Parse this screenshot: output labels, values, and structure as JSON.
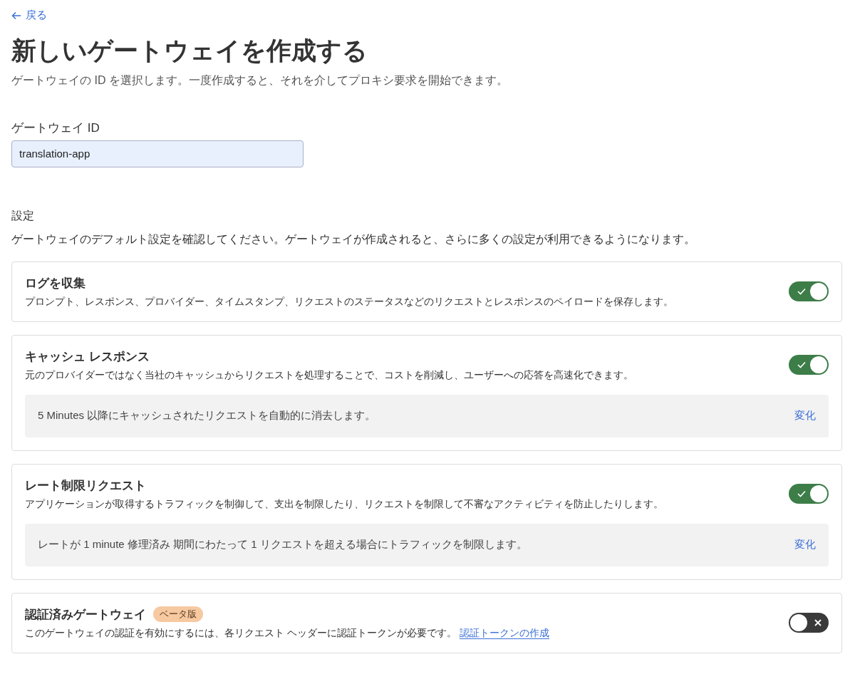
{
  "back_link": {
    "label": "戻る"
  },
  "page": {
    "title": "新しいゲートウェイを作成する",
    "subtitle": "ゲートウェイの ID を選択します。一度作成すると、それを介してプロキシ要求を開始できます。"
  },
  "gateway_id": {
    "label": "ゲートウェイ ID",
    "value": "translation-app"
  },
  "settings": {
    "heading": "設定",
    "description": "ゲートウェイのデフォルト設定を確認してください。ゲートウェイが作成されると、さらに多くの設定が利用できるようになります。",
    "items": [
      {
        "title": "ログを収集",
        "description": "プロンプト、レスポンス、プロバイダー、タイムスタンプ、リクエストのステータスなどのリクエストとレスポンスのペイロードを保存します。",
        "on": true
      },
      {
        "title": "キャッシュ レスポンス",
        "description": "元のプロバイダーではなく当社のキャッシュからリクエストを処理することで、コストを削減し、ユーザーへの応答を高速化できます。",
        "on": true,
        "detail": {
          "text": "5 Minutes 以降にキャッシュされたリクエストを自動的に消去します。",
          "action": "変化"
        }
      },
      {
        "title": "レート制限リクエスト",
        "description": "アプリケーションが取得するトラフィックを制御して、支出を制限したり、リクエストを制限して不審なアクティビティを防止したりします。",
        "on": true,
        "detail": {
          "text": "レートが 1 minute 修理済み 期間にわたって 1 リクエストを超える場合にトラフィックを制限します。",
          "action": "変化"
        }
      },
      {
        "title": "認証済みゲートウェイ",
        "badge": "ベータ版",
        "description": "このゲートウェイの認証を有効にするには、各リクエスト ヘッダーに認証トークンが必要です。",
        "link": "認証トークンの作成",
        "on": false
      }
    ]
  }
}
